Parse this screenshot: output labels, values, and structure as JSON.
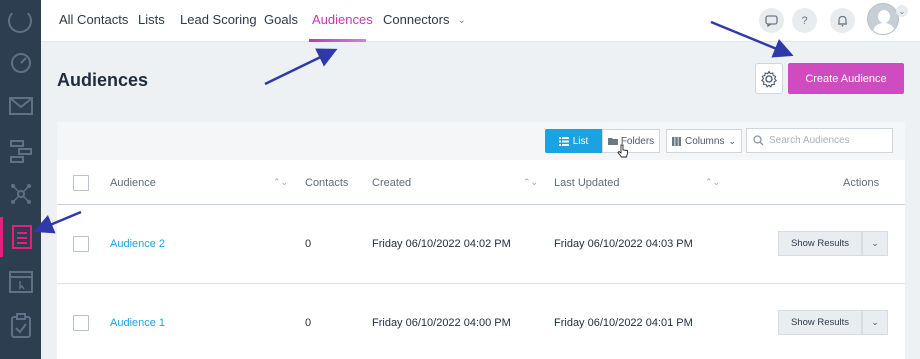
{
  "topnav": {
    "tabs": [
      {
        "label": "All Contacts"
      },
      {
        "label": "Lists"
      },
      {
        "label": "Lead Scoring"
      },
      {
        "label": "Goals"
      },
      {
        "label": "Audiences"
      },
      {
        "label": "Connectors"
      }
    ],
    "active_tab": "Audiences",
    "help_label": "?",
    "accent_color": "#c13aa6"
  },
  "sidebar": {
    "icons": [
      "logo-icon",
      "dashboard-icon",
      "email-icon",
      "workflow-icon",
      "network-icon",
      "contacts-icon",
      "landing-page-icon",
      "forms-icon"
    ],
    "active_item": "contacts-icon",
    "active_color": "#e2207e"
  },
  "page": {
    "title": "Audiences",
    "create_button": "Create Audience",
    "create_color": "#cf4bbf"
  },
  "toolbar": {
    "list_label": "List",
    "folders_label": "Folders",
    "columns_label": "Columns",
    "search_placeholder": "Search Audiences",
    "list_color": "#1ba3e1"
  },
  "table": {
    "headers": {
      "audience": "Audience",
      "contacts": "Contacts",
      "created": "Created",
      "last_updated": "Last Updated",
      "actions": "Actions"
    },
    "rows": [
      {
        "name": "Audience 2",
        "contacts": "0",
        "created": "Friday 06/10/2022 04:02 PM",
        "updated": "Friday 06/10/2022 04:03 PM",
        "action": "Show Results"
      },
      {
        "name": "Audience 1",
        "contacts": "0",
        "created": "Friday 06/10/2022 04:00 PM",
        "updated": "Friday 06/10/2022 04:01 PM",
        "action": "Show Results"
      }
    ]
  },
  "annotation_color": "#2f3aa8"
}
